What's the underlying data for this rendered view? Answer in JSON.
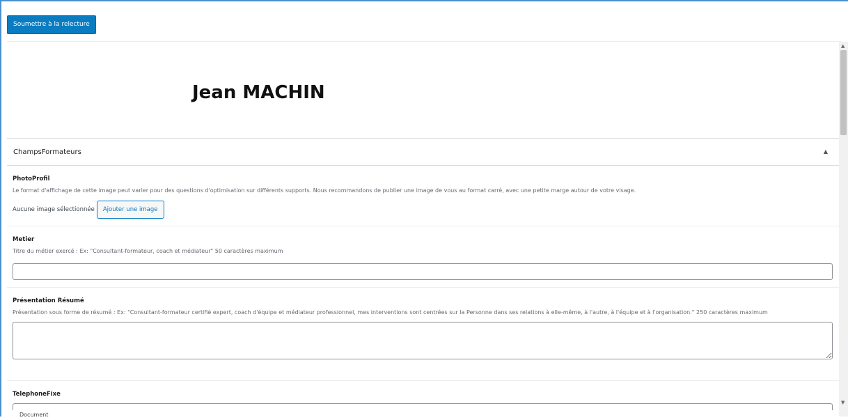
{
  "toolbar": {
    "submit_label": "Soumettre à la relecture"
  },
  "post": {
    "title": "Jean MACHIN"
  },
  "metabox": {
    "title": "ChampsFormateurs",
    "toggle_icon": "caret-up-icon"
  },
  "fields": {
    "photo": {
      "label": "PhotoProfil",
      "description": "Le format d'affichage de cette image peut varier pour des questions d'optimisation sur différents supports. Nous recommandons de publier une image de vous au format carré, avec une petite marge autour de votre visage.",
      "no_image_text": "Aucune image sélectionnée",
      "add_button": "Ajouter une image"
    },
    "metier": {
      "label": "Metier",
      "description": "Titre du métier exercé : Ex: \"Consultant-formateur, coach et médiateur\" 50 caractères maximum",
      "value": ""
    },
    "presentation": {
      "label": "Présentation Résumé",
      "description": "Présentation sous forme de résumé : Ex: \"Consultant-formateur certifié expert, coach d'équipe et médiateur professionnel, mes interventions sont centrées sur la Personne dans ses relations à elle-même, à l'autre, à l'équipe et à l'organisation.\" 250 caractères maximum",
      "value": ""
    },
    "telephone": {
      "label": "TelephoneFixe",
      "value": ""
    }
  },
  "status_bar": {
    "breadcrumb": "Document"
  },
  "scrollbar": {
    "up_icon": "▲",
    "down_icon": "▼"
  }
}
